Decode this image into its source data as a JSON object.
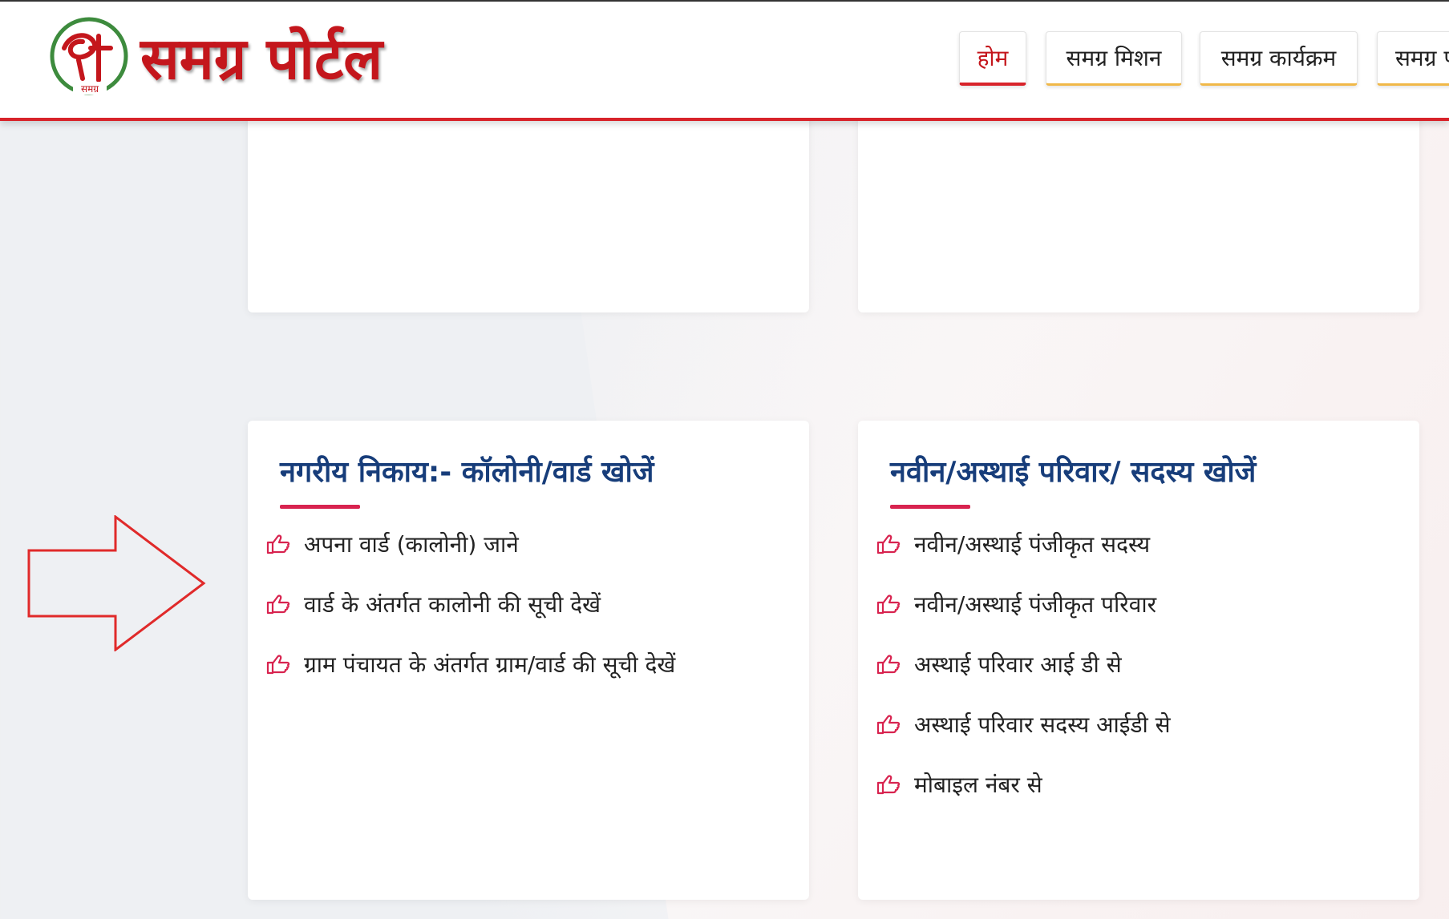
{
  "header": {
    "brand": "समग्र पोर्टल",
    "logo_caption": "समग्र",
    "nav": [
      {
        "label": "होम",
        "active": true
      },
      {
        "label": "समग्र मिशन",
        "active": false
      },
      {
        "label": "समग्र कार्यक्रम",
        "active": false
      },
      {
        "label": "समग्र प",
        "active": false
      }
    ]
  },
  "cards": {
    "left": {
      "title": "नगरीय निकाय:- कॉलोनी/वार्ड खोजें",
      "items": [
        "अपना वार्ड (कालोनी) जाने",
        "वार्ड के अंतर्गत कालोनी की सूची देखें",
        "ग्राम पंचायत के अंतर्गत ग्राम/वार्ड की सूची देखें"
      ]
    },
    "right": {
      "title": "नवीन/अस्थाई परिवार/ सदस्य खोजें",
      "items": [
        "नवीन/अस्थाई पंजीकृत सदस्य",
        "नवीन/अस्थाई पंजीकृत परिवार",
        "अस्थाई परिवार आई डी से",
        "अस्थाई परिवार सदस्य आईडी से",
        "मोबाइल नंबर से"
      ]
    }
  },
  "icons": {
    "logo": "samagra-logo-icon",
    "list_bullet": "pointing-hand-icon",
    "annotation": "right-arrow-icon"
  },
  "colors": {
    "brand_red": "#c4161c",
    "title_blue": "#173d7a",
    "accent_pink": "#d8234f",
    "nav_underline": "#f0b848",
    "logo_green": "#3d8b3d"
  }
}
